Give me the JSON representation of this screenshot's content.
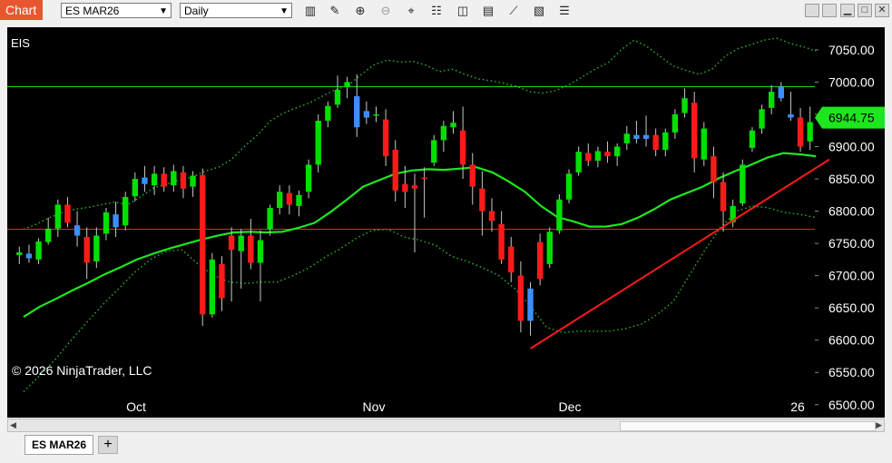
{
  "toolbar": {
    "chart_label": "Chart",
    "instrument": "ES MAR26",
    "interval": "Daily",
    "icons": [
      "bars-type-icon",
      "draw-pencil-icon",
      "zoom-in-icon",
      "zoom-out-icon",
      "crosshair-icon",
      "data-box-icon",
      "strategies-icon",
      "indicators-icon",
      "drawing-tools-icon",
      "properties-icon",
      "more-icon"
    ],
    "window_buttons": [
      "share-icon",
      "minimize-icon",
      "maximize-icon",
      "close-icon"
    ]
  },
  "chart": {
    "symbol_label": "EIS",
    "copyright": "© 2026 NinjaTrader, LLC",
    "last_price": "6944.75",
    "price_ticks": [
      "7050.00",
      "7000.00",
      "6950.00",
      "6900.00",
      "6850.00",
      "6800.00",
      "6750.00",
      "6700.00",
      "6650.00",
      "6600.00",
      "6550.00",
      "6500.00"
    ],
    "date_labels": [
      "Oct",
      "Nov",
      "Dec",
      "26"
    ],
    "colors": {
      "up": "#00e000",
      "down": "#ff1a1a",
      "neutral": "#3c8eff",
      "sma": "#1ee61e",
      "bands": "#2eb82e",
      "background": "#000000",
      "trendline": "#ff1a1a",
      "resistance": "#1ee61e"
    }
  },
  "chart_data": {
    "type": "candlestick",
    "ylim": [
      6480,
      7085
    ],
    "yticks": [
      7050,
      7000,
      6950,
      6900,
      6850,
      6800,
      6750,
      6700,
      6650,
      6600,
      6550,
      6500
    ],
    "x_labels": [
      "Oct",
      "Nov",
      "Dec",
      "26"
    ],
    "last_price": 6944.75,
    "candles": [
      {
        "o": 6732,
        "h": 6745,
        "l": 6718,
        "c": 6736,
        "col": "up"
      },
      {
        "o": 6734,
        "h": 6748,
        "l": 6720,
        "c": 6727,
        "col": "neutral"
      },
      {
        "o": 6725,
        "h": 6758,
        "l": 6718,
        "c": 6753,
        "col": "up"
      },
      {
        "o": 6752,
        "h": 6790,
        "l": 6748,
        "c": 6773,
        "col": "up"
      },
      {
        "o": 6773,
        "h": 6818,
        "l": 6760,
        "c": 6810,
        "col": "up"
      },
      {
        "o": 6810,
        "h": 6822,
        "l": 6775,
        "c": 6782,
        "col": "down"
      },
      {
        "o": 6778,
        "h": 6800,
        "l": 6745,
        "c": 6762,
        "col": "neutral"
      },
      {
        "o": 6760,
        "h": 6775,
        "l": 6695,
        "c": 6720,
        "col": "down"
      },
      {
        "o": 6722,
        "h": 6775,
        "l": 6712,
        "c": 6762,
        "col": "up"
      },
      {
        "o": 6765,
        "h": 6805,
        "l": 6755,
        "c": 6798,
        "col": "up"
      },
      {
        "o": 6795,
        "h": 6815,
        "l": 6760,
        "c": 6775,
        "col": "neutral"
      },
      {
        "o": 6778,
        "h": 6830,
        "l": 6770,
        "c": 6822,
        "col": "up"
      },
      {
        "o": 6823,
        "h": 6860,
        "l": 6815,
        "c": 6850,
        "col": "up"
      },
      {
        "o": 6852,
        "h": 6870,
        "l": 6830,
        "c": 6842,
        "col": "neutral"
      },
      {
        "o": 6840,
        "h": 6870,
        "l": 6825,
        "c": 6858,
        "col": "up"
      },
      {
        "o": 6858,
        "h": 6868,
        "l": 6830,
        "c": 6838,
        "col": "down"
      },
      {
        "o": 6840,
        "h": 6872,
        "l": 6830,
        "c": 6862,
        "col": "up"
      },
      {
        "o": 6860,
        "h": 6870,
        "l": 6820,
        "c": 6835,
        "col": "down"
      },
      {
        "o": 6838,
        "h": 6862,
        "l": 6822,
        "c": 6855,
        "col": "up"
      },
      {
        "o": 6856,
        "h": 6866,
        "l": 6622,
        "c": 6640,
        "col": "down"
      },
      {
        "o": 6640,
        "h": 6735,
        "l": 6635,
        "c": 6725,
        "col": "up"
      },
      {
        "o": 6718,
        "h": 6730,
        "l": 6645,
        "c": 6665,
        "col": "down"
      },
      {
        "o": 6762,
        "h": 6775,
        "l": 6660,
        "c": 6740,
        "col": "down"
      },
      {
        "o": 6738,
        "h": 6772,
        "l": 6680,
        "c": 6762,
        "col": "up"
      },
      {
        "o": 6762,
        "h": 6788,
        "l": 6710,
        "c": 6720,
        "col": "down"
      },
      {
        "o": 6720,
        "h": 6770,
        "l": 6660,
        "c": 6755,
        "col": "up"
      },
      {
        "o": 6772,
        "h": 6810,
        "l": 6762,
        "c": 6805,
        "col": "up"
      },
      {
        "o": 6805,
        "h": 6840,
        "l": 6795,
        "c": 6830,
        "col": "up"
      },
      {
        "o": 6828,
        "h": 6840,
        "l": 6795,
        "c": 6810,
        "col": "down"
      },
      {
        "o": 6808,
        "h": 6832,
        "l": 6792,
        "c": 6825,
        "col": "up"
      },
      {
        "o": 6830,
        "h": 6880,
        "l": 6820,
        "c": 6872,
        "col": "up"
      },
      {
        "o": 6872,
        "h": 6950,
        "l": 6860,
        "c": 6940,
        "col": "up"
      },
      {
        "o": 6940,
        "h": 6970,
        "l": 6930,
        "c": 6963,
        "col": "up"
      },
      {
        "o": 6965,
        "h": 7010,
        "l": 6960,
        "c": 6988,
        "col": "up"
      },
      {
        "o": 6992,
        "h": 7008,
        "l": 6975,
        "c": 7000,
        "col": "up"
      },
      {
        "o": 6978,
        "h": 7012,
        "l": 6915,
        "c": 6930,
        "col": "neutral"
      },
      {
        "o": 6955,
        "h": 6970,
        "l": 6935,
        "c": 6945,
        "col": "neutral"
      },
      {
        "o": 6948,
        "h": 6962,
        "l": 6938,
        "c": 6950,
        "col": "up"
      },
      {
        "o": 6942,
        "h": 6958,
        "l": 6870,
        "c": 6885,
        "col": "down"
      },
      {
        "o": 6895,
        "h": 6910,
        "l": 6815,
        "c": 6832,
        "col": "down"
      },
      {
        "o": 6842,
        "h": 6870,
        "l": 6805,
        "c": 6830,
        "col": "down"
      },
      {
        "o": 6840,
        "h": 6858,
        "l": 6736,
        "c": 6835,
        "col": "down"
      },
      {
        "o": 6852,
        "h": 6868,
        "l": 6790,
        "c": 6850,
        "col": "down"
      },
      {
        "o": 6875,
        "h": 6918,
        "l": 6870,
        "c": 6910,
        "col": "up"
      },
      {
        "o": 6910,
        "h": 6940,
        "l": 6892,
        "c": 6932,
        "col": "up"
      },
      {
        "o": 6930,
        "h": 6955,
        "l": 6920,
        "c": 6937,
        "col": "up"
      },
      {
        "o": 6925,
        "h": 6962,
        "l": 6850,
        "c": 6872,
        "col": "down"
      },
      {
        "o": 6872,
        "h": 6890,
        "l": 6810,
        "c": 6838,
        "col": "down"
      },
      {
        "o": 6835,
        "h": 6862,
        "l": 6762,
        "c": 6800,
        "col": "down"
      },
      {
        "o": 6800,
        "h": 6820,
        "l": 6768,
        "c": 6785,
        "col": "down"
      },
      {
        "o": 6780,
        "h": 6800,
        "l": 6718,
        "c": 6725,
        "col": "down"
      },
      {
        "o": 6745,
        "h": 6760,
        "l": 6690,
        "c": 6705,
        "col": "down"
      },
      {
        "o": 6700,
        "h": 6722,
        "l": 6612,
        "c": 6630,
        "col": "down"
      },
      {
        "o": 6630,
        "h": 6690,
        "l": 6607,
        "c": 6680,
        "col": "neutral"
      },
      {
        "o": 6752,
        "h": 6765,
        "l": 6685,
        "c": 6695,
        "col": "down"
      },
      {
        "o": 6718,
        "h": 6775,
        "l": 6712,
        "c": 6768,
        "col": "up"
      },
      {
        "o": 6770,
        "h": 6826,
        "l": 6765,
        "c": 6818,
        "col": "up"
      },
      {
        "o": 6818,
        "h": 6865,
        "l": 6812,
        "c": 6858,
        "col": "up"
      },
      {
        "o": 6860,
        "h": 6900,
        "l": 6855,
        "c": 6892,
        "col": "up"
      },
      {
        "o": 6890,
        "h": 6905,
        "l": 6870,
        "c": 6878,
        "col": "down"
      },
      {
        "o": 6878,
        "h": 6900,
        "l": 6868,
        "c": 6893,
        "col": "up"
      },
      {
        "o": 6892,
        "h": 6908,
        "l": 6875,
        "c": 6885,
        "col": "down"
      },
      {
        "o": 6885,
        "h": 6905,
        "l": 6870,
        "c": 6900,
        "col": "up"
      },
      {
        "o": 6905,
        "h": 6932,
        "l": 6895,
        "c": 6920,
        "col": "up"
      },
      {
        "o": 6918,
        "h": 6940,
        "l": 6905,
        "c": 6912,
        "col": "neutral"
      },
      {
        "o": 6912,
        "h": 6948,
        "l": 6900,
        "c": 6918,
        "col": "neutral"
      },
      {
        "o": 6918,
        "h": 6928,
        "l": 6885,
        "c": 6895,
        "col": "down"
      },
      {
        "o": 6895,
        "h": 6928,
        "l": 6885,
        "c": 6922,
        "col": "up"
      },
      {
        "o": 6922,
        "h": 6958,
        "l": 6912,
        "c": 6950,
        "col": "up"
      },
      {
        "o": 6952,
        "h": 6990,
        "l": 6945,
        "c": 6975,
        "col": "up"
      },
      {
        "o": 6968,
        "h": 6985,
        "l": 6860,
        "c": 6882,
        "col": "down"
      },
      {
        "o": 6880,
        "h": 6938,
        "l": 6870,
        "c": 6928,
        "col": "up"
      },
      {
        "o": 6885,
        "h": 6900,
        "l": 6820,
        "c": 6845,
        "col": "down"
      },
      {
        "o": 6845,
        "h": 6860,
        "l": 6768,
        "c": 6800,
        "col": "down"
      },
      {
        "o": 6783,
        "h": 6818,
        "l": 6775,
        "c": 6808,
        "col": "up"
      },
      {
        "o": 6812,
        "h": 6880,
        "l": 6808,
        "c": 6872,
        "col": "up"
      },
      {
        "o": 6898,
        "h": 6930,
        "l": 6892,
        "c": 6925,
        "col": "up"
      },
      {
        "o": 6928,
        "h": 6965,
        "l": 6920,
        "c": 6958,
        "col": "up"
      },
      {
        "o": 6960,
        "h": 6995,
        "l": 6950,
        "c": 6985,
        "col": "up"
      },
      {
        "o": 6993,
        "h": 7000,
        "l": 6970,
        "c": 6975,
        "col": "neutral"
      },
      {
        "o": 6945,
        "h": 6985,
        "l": 6940,
        "c": 6950,
        "col": "neutral"
      },
      {
        "o": 6945,
        "h": 6960,
        "l": 6892,
        "c": 6900,
        "col": "down"
      },
      {
        "o": 6908,
        "h": 6962,
        "l": 6895,
        "c": 6938,
        "col": "up"
      }
    ],
    "sma": [
      6636,
      6652,
      6664,
      6677,
      6689,
      6702,
      6713,
      6725,
      6734,
      6742,
      6749,
      6756,
      6762,
      6767,
      6768,
      6767,
      6768,
      6774,
      6782,
      6799,
      6818,
      6838,
      6848,
      6858,
      6863,
      6865,
      6864,
      6866,
      6868,
      6860,
      6846,
      6830,
      6808,
      6791,
      6784,
      6776,
      6776,
      6780,
      6790,
      6803,
      6818,
      6828,
      6838,
      6851,
      6862,
      6872,
      6883,
      6890,
      6888,
      6885
    ],
    "upper_band": [
      6772,
      6780,
      6790,
      6798,
      6803,
      6806,
      6810,
      6814,
      6810,
      6822,
      6836,
      6842,
      6848,
      6853,
      6862,
      6868,
      6880,
      6900,
      6918,
      6940,
      6952,
      6960,
      6968,
      6978,
      6988,
      6995,
      7012,
      7027,
      7034,
      7031,
      7032,
      7026,
      7016,
      7020,
      7012,
      7005,
      7002,
      6998,
      6993,
      6985,
      6983,
      6987,
      6996,
      7008,
      7020,
      7030,
      7050,
      7065,
      7055,
      7040,
      7025,
      7018,
      7012,
      7020,
      7040,
      7052,
      7058,
      7065,
      7068,
      7060,
      7055,
      7048
    ],
    "lower_band": [
      6520,
      6545,
      6570,
      6600,
      6628,
      6655,
      6680,
      6705,
      6725,
      6738,
      6740,
      6718,
      6700,
      6690,
      6688,
      6690,
      6690,
      6700,
      6712,
      6728,
      6742,
      6758,
      6770,
      6772,
      6760,
      6755,
      6747,
      6730,
      6722,
      6712,
      6700,
      6680,
      6652,
      6620,
      6612,
      6614,
      6614,
      6614,
      6618,
      6625,
      6640,
      6660,
      6700,
      6740,
      6775,
      6800,
      6808,
      6805,
      6798,
      6795,
      6790
    ],
    "horizontal_levels": [
      {
        "price": 6993,
        "color": "resistance",
        "style": "solid"
      },
      {
        "price": 6772,
        "color": "down",
        "style": "solid"
      }
    ],
    "trendline": {
      "from": {
        "bar": 53,
        "price": 6587
      },
      "to": {
        "bar": 84,
        "price": 6880
      }
    }
  }
}
